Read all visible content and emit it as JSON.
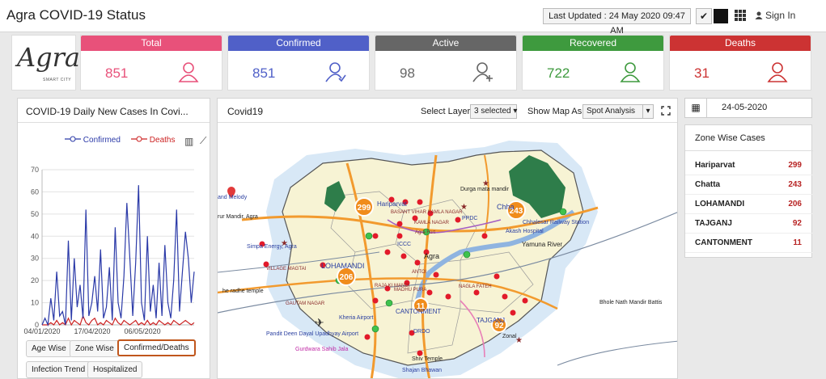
{
  "app": {
    "title": "Agra COVID-19 Status",
    "last_updated": "Last Updated : 24 May 2020 09:47 AM",
    "sign_in": "Sign In"
  },
  "logo": {
    "text": "Agra",
    "sub": "SMART CITY"
  },
  "stats": [
    {
      "label": "Total",
      "value": "851",
      "color": "#e8517a",
      "icon": "person-icon"
    },
    {
      "label": "Confirmed",
      "value": "851",
      "color": "#5060c8",
      "icon": "person-check-icon"
    },
    {
      "label": "Active",
      "value": "98",
      "color": "#666666",
      "icon": "person-add-icon"
    },
    {
      "label": "Recovered",
      "value": "722",
      "color": "#3e9a3e",
      "icon": "person-icon"
    },
    {
      "label": "Deaths",
      "value": "31",
      "color": "#cc3333",
      "icon": "person-icon"
    }
  ],
  "chart_panel": {
    "title": "COVID-19 Daily New Cases In Covi...",
    "legend": [
      "Confirmed",
      "Deaths"
    ],
    "buttons": [
      "Age Wise",
      "Zone Wise",
      "Confirmed/Deaths",
      "Infection Trend",
      "Hospitalized"
    ]
  },
  "chart_data": {
    "type": "line",
    "title": "COVID-19 Daily New Cases In Covi...",
    "x_tick_labels": [
      "04/01/2020",
      "17/04/2020",
      "06/05/2020"
    ],
    "ylim": [
      0,
      70
    ],
    "y_ticks": [
      0,
      10,
      20,
      30,
      40,
      50,
      60,
      70
    ],
    "series": [
      {
        "name": "Confirmed",
        "color": "#2b3aa8",
        "values": [
          0,
          3,
          0,
          12,
          2,
          24,
          4,
          6,
          0,
          38,
          2,
          30,
          8,
          18,
          3,
          52,
          4,
          10,
          22,
          6,
          34,
          3,
          8,
          26,
          2,
          44,
          10,
          3,
          22,
          55,
          30,
          4,
          28,
          63,
          10,
          2,
          40,
          6,
          18,
          3,
          28,
          4,
          36,
          10,
          3,
          20,
          52,
          6,
          24,
          42,
          30,
          10,
          24
        ]
      },
      {
        "name": "Deaths",
        "color": "#cc2222",
        "values": [
          0,
          0,
          0,
          1,
          0,
          2,
          0,
          1,
          0,
          3,
          0,
          2,
          1,
          0,
          4,
          1,
          0,
          2,
          3,
          0,
          1,
          0,
          2,
          1,
          0,
          3,
          1,
          0,
          2,
          1,
          0,
          1,
          2,
          0,
          1,
          0,
          2,
          0,
          1,
          0,
          2,
          1,
          0,
          1,
          0,
          2,
          1,
          0,
          1,
          2,
          1,
          0,
          1
        ]
      }
    ],
    "grid": true,
    "legend_position": "top"
  },
  "map_panel": {
    "title": "Covid19",
    "select_layer_label": "Select Layer",
    "select_layer_value": "3 selected",
    "show_map_as_label": "Show Map As",
    "show_map_as_value": "Spot Analysis",
    "markers": [
      {
        "label": "299"
      },
      {
        "label": "243"
      },
      {
        "label": "206"
      },
      {
        "label": "11"
      },
      {
        "label": "92"
      }
    ],
    "place_labels": [
      "Durga mata mandir",
      "Hariparvat",
      "BASANT VIHAR KAMLA NAGAR",
      "KAMLA NAGAR",
      "PPDC",
      "Chhalesar Railway Station",
      "Akash Hospital",
      "Yamuna River",
      "Simpa Energy, Agra",
      "Agra",
      "LOHAMANDI",
      "VILLAGE MAGTAI",
      "ICCC",
      "RAJA KI MANDI",
      "ANTOI",
      "MADHU PURA",
      "NAGLA FATEH",
      "CANTONMENT",
      "TAJGANJ",
      "Bhole Nath Mandir Battis",
      "Kheria Airport",
      "Pandit Deen Dayal Upadhyay Airport",
      "DRDO",
      "Gurdwara Sahib Jala",
      "Shiv Temple",
      "Shajan Bhawan",
      "Zonal",
      "and Melody",
      "rur Mandir, Agra",
      "he radhe temple",
      "GAUTAM NAGAR",
      "Agra Fort",
      "Chha"
    ]
  },
  "date_filter": {
    "value": "24-05-2020"
  },
  "zones": {
    "title": "Zone Wise Cases",
    "rows": [
      {
        "name": "Hariparvat",
        "count": "299"
      },
      {
        "name": "Chatta",
        "count": "243"
      },
      {
        "name": "LOHAMANDI",
        "count": "206"
      },
      {
        "name": "TAJGANJ",
        "count": "92"
      },
      {
        "name": "CANTONMENT",
        "count": "11"
      }
    ]
  }
}
